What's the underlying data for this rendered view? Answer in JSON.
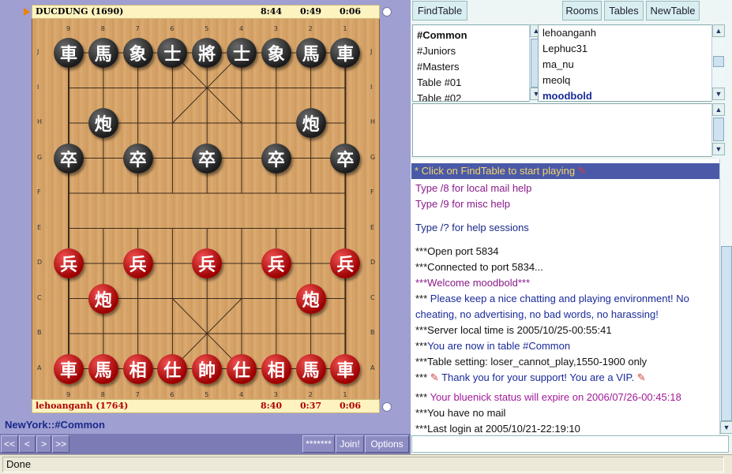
{
  "game": {
    "top_player": {
      "name": "DUCDUNG (1690)",
      "time1": "8:44",
      "time2": "0:49",
      "time3": "0:06"
    },
    "bottom_player": {
      "name": "lehoanganh (1764)",
      "time1": "8:40",
      "time2": "0:37",
      "time3": "0:06"
    },
    "file_labels": [
      "9",
      "8",
      "7",
      "6",
      "5",
      "4",
      "3",
      "2",
      "1"
    ],
    "rank_labels": [
      "J",
      "I",
      "H",
      "G",
      "F",
      "E",
      "D",
      "C",
      "B",
      "A"
    ],
    "pieces": [
      {
        "c": "車",
        "s": "black",
        "col": 0,
        "row": 0
      },
      {
        "c": "馬",
        "s": "black",
        "col": 1,
        "row": 0
      },
      {
        "c": "象",
        "s": "black",
        "col": 2,
        "row": 0
      },
      {
        "c": "士",
        "s": "black",
        "col": 3,
        "row": 0
      },
      {
        "c": "將",
        "s": "black",
        "col": 4,
        "row": 0
      },
      {
        "c": "士",
        "s": "black",
        "col": 5,
        "row": 0
      },
      {
        "c": "象",
        "s": "black",
        "col": 6,
        "row": 0
      },
      {
        "c": "馬",
        "s": "black",
        "col": 7,
        "row": 0
      },
      {
        "c": "車",
        "s": "black",
        "col": 8,
        "row": 0
      },
      {
        "c": "炮",
        "s": "black",
        "col": 1,
        "row": 2
      },
      {
        "c": "炮",
        "s": "black",
        "col": 7,
        "row": 2
      },
      {
        "c": "卒",
        "s": "black",
        "col": 0,
        "row": 3
      },
      {
        "c": "卒",
        "s": "black",
        "col": 2,
        "row": 3
      },
      {
        "c": "卒",
        "s": "black",
        "col": 4,
        "row": 3
      },
      {
        "c": "卒",
        "s": "black",
        "col": 6,
        "row": 3
      },
      {
        "c": "卒",
        "s": "black",
        "col": 8,
        "row": 3
      },
      {
        "c": "兵",
        "s": "red",
        "col": 0,
        "row": 6
      },
      {
        "c": "兵",
        "s": "red",
        "col": 2,
        "row": 6
      },
      {
        "c": "兵",
        "s": "red",
        "col": 4,
        "row": 6
      },
      {
        "c": "兵",
        "s": "red",
        "col": 6,
        "row": 6
      },
      {
        "c": "兵",
        "s": "red",
        "col": 8,
        "row": 6
      },
      {
        "c": "炮",
        "s": "red",
        "col": 1,
        "row": 7
      },
      {
        "c": "炮",
        "s": "red",
        "col": 7,
        "row": 7
      },
      {
        "c": "車",
        "s": "red",
        "col": 0,
        "row": 9
      },
      {
        "c": "馬",
        "s": "red",
        "col": 1,
        "row": 9
      },
      {
        "c": "相",
        "s": "red",
        "col": 2,
        "row": 9
      },
      {
        "c": "仕",
        "s": "red",
        "col": 3,
        "row": 9
      },
      {
        "c": "帥",
        "s": "red",
        "col": 4,
        "row": 9
      },
      {
        "c": "仕",
        "s": "red",
        "col": 5,
        "row": 9
      },
      {
        "c": "相",
        "s": "red",
        "col": 6,
        "row": 9
      },
      {
        "c": "馬",
        "s": "red",
        "col": 7,
        "row": 9
      },
      {
        "c": "車",
        "s": "red",
        "col": 8,
        "row": 9
      }
    ]
  },
  "table_label": "NewYork::#Common",
  "nav": {
    "first": "<<",
    "prev": "<",
    "next": ">",
    "last": ">>",
    "password": "*******",
    "join": "Join!",
    "options": "Options"
  },
  "toolbar": {
    "find_table": "FindTable",
    "rooms": "Rooms",
    "tables": "Tables",
    "new_table": "NewTable"
  },
  "rooms": [
    "#Common",
    "#Juniors",
    "#Masters",
    "Table #01",
    "Table #02"
  ],
  "users": [
    "lehoanganh",
    "Lephuc31",
    "ma_nu",
    "meolq",
    "moodbold"
  ],
  "chat": [
    {
      "text": "* Click on FindTable to start playing",
      "color": "#f7d56a",
      "pin": true,
      "highlight": true
    },
    {
      "text": "Type /8 for local mail help",
      "color": "#8a1a8a"
    },
    {
      "text": "Type /9 for misc help",
      "color": "#8a1a8a"
    },
    {
      "text": "",
      "color": "#000"
    },
    {
      "text": "Type /? for help sessions",
      "color": "#1a2a8a"
    },
    {
      "text": "",
      "color": "#000"
    },
    {
      "text": "***Open port 5834",
      "color": "#111"
    },
    {
      "text": "***Connected to port 5834...",
      "color": "#111"
    },
    {
      "text": "***Welcome moodbold***",
      "color": "#8a1a8a"
    },
    {
      "text": "*** Please keep a nice chatting and playing environment! No",
      "color": "#1a2a9a",
      "prefix": "*** ",
      "prefixColor": "#111"
    },
    {
      "text": "  cheating, no advertising, no bad words, no harassing!",
      "color": "#1a2a9a"
    },
    {
      "text": "***Server local time is 2005/10/25-00:55:41",
      "color": "#111"
    },
    {
      "text": "***You are now in table #Common",
      "color": "#1a2a9a",
      "prefix": "***",
      "prefixColor": "#111"
    },
    {
      "text": "***Table setting: loser_cannot_play,1550-1900 only",
      "color": "#111"
    },
    {
      "text": "Thank you for your support! You are a VIP.",
      "color": "#1a2a9a",
      "vip": true
    },
    {
      "text": "*** Your bluenick status will expire on 2006/07/26-00:45:18",
      "color": "#a01a9a",
      "prefix": "*** ",
      "prefixColor": "#111"
    },
    {
      "text": "***You have no mail",
      "color": "#111"
    },
    {
      "text": "***Last login at 2005/10/21-22:19:10",
      "color": "#111"
    }
  ],
  "status": "Done"
}
